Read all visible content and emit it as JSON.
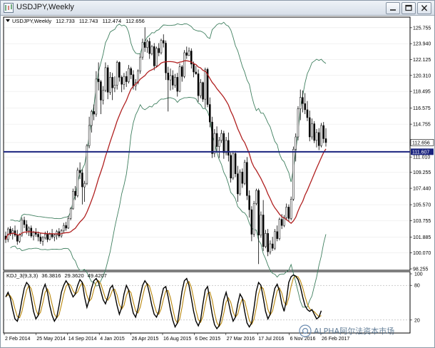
{
  "window": {
    "title": "USDJPY,Weekly"
  },
  "chart_info": {
    "symbol_line": "USDJPY,Weekly",
    "open": "112.733",
    "high": "112.743",
    "low": "112.474",
    "close": "112.656"
  },
  "indicator_info": {
    "name": "KDJ_3(9,3,3)",
    "k": "36.3816",
    "d": "29.3620",
    "j": "49.4207"
  },
  "price_axis": {
    "ticks": [
      "125.755",
      "123.940",
      "122.125",
      "120.310",
      "118.495",
      "116.575",
      "114.755",
      "112.656",
      "111.607",
      "111.010",
      "109.255",
      "107.440",
      "105.570",
      "103.755",
      "101.885",
      "100.070",
      "98.255"
    ],
    "current_price": "112.656",
    "line_price": "111.607"
  },
  "indicator_axis": {
    "ticks": [
      "100",
      "80",
      "20"
    ]
  },
  "time_axis": {
    "labels": [
      "2 Feb 2014",
      "25 May 2014",
      "14 Sep 2014",
      "4 Jan 2015",
      "26 Apr 2015",
      "16 Aug 2015",
      "6 Dec 2015",
      "27 Mar 2016",
      "17 Jul 2016",
      "6 Nov 2016",
      "26 Feb 2017"
    ]
  },
  "watermark": {
    "text": "ALPHA阿尔法资本市场"
  },
  "colors": {
    "bull": "#ffffff",
    "bear": "#000000",
    "ma": "#b02020",
    "bands": "#3f7f5f",
    "hline": "#1a237e",
    "k_line": "#000000",
    "d_line": "#b8860b",
    "grid": "#e4e4e4"
  },
  "chart_data": {
    "type": "candlestick",
    "title": "USDJPY,Weekly",
    "price_range": [
      98.255,
      126.8
    ],
    "horizontal_line": 111.607,
    "overlays": [
      "moving average (red)",
      "Bollinger bands (green)"
    ],
    "indicator": "KDJ_3(9,3,3)",
    "indicator_range": [
      0,
      100
    ],
    "bars": [
      [
        102.0,
        102.5,
        101.2,
        101.6
      ],
      [
        101.6,
        103.0,
        101.3,
        102.8
      ],
      [
        102.8,
        103.1,
        102.0,
        102.3
      ],
      [
        102.3,
        102.9,
        101.6,
        102.6
      ],
      [
        102.6,
        103.2,
        101.9,
        102.1
      ],
      [
        102.1,
        102.7,
        101.0,
        101.4
      ],
      [
        101.4,
        102.3,
        101.2,
        102.1
      ],
      [
        102.1,
        104.1,
        101.9,
        103.8
      ],
      [
        103.8,
        104.2,
        102.9,
        103.3
      ],
      [
        103.3,
        103.8,
        102.2,
        102.6
      ],
      [
        102.6,
        103.1,
        102.0,
        102.9
      ],
      [
        102.9,
        103.2,
        101.8,
        102.0
      ],
      [
        102.0,
        102.6,
        101.5,
        102.4
      ],
      [
        102.4,
        102.9,
        101.9,
        102.2
      ],
      [
        102.2,
        102.5,
        101.4,
        101.9
      ],
      [
        101.9,
        102.4,
        101.1,
        101.4
      ],
      [
        101.4,
        102.0,
        100.9,
        101.8
      ],
      [
        101.8,
        102.5,
        101.6,
        102.2
      ],
      [
        102.2,
        102.6,
        101.3,
        101.6
      ],
      [
        101.6,
        102.4,
        101.5,
        102.2
      ],
      [
        102.2,
        102.8,
        101.7,
        101.9
      ],
      [
        101.9,
        102.3,
        101.4,
        102.1
      ],
      [
        102.1,
        102.7,
        101.6,
        102.5
      ],
      [
        102.5,
        102.9,
        101.8,
        102.0
      ],
      [
        102.0,
        102.8,
        101.8,
        102.6
      ],
      [
        102.6,
        103.5,
        102.3,
        103.2
      ],
      [
        103.2,
        103.6,
        102.6,
        102.9
      ],
      [
        102.9,
        104.3,
        102.8,
        104.0
      ],
      [
        104.0,
        105.3,
        103.8,
        105.1
      ],
      [
        105.1,
        107.4,
        105.0,
        107.1
      ],
      [
        107.1,
        107.7,
        106.1,
        106.6
      ],
      [
        106.6,
        109.8,
        106.4,
        109.5
      ],
      [
        109.5,
        110.4,
        108.5,
        109.2
      ],
      [
        109.2,
        109.6,
        105.6,
        107.6
      ],
      [
        107.6,
        108.3,
        105.9,
        108.0
      ],
      [
        108.0,
        112.5,
        107.8,
        112.3
      ],
      [
        112.3,
        115.6,
        112.0,
        114.6
      ],
      [
        114.6,
        116.4,
        113.8,
        116.2
      ],
      [
        116.2,
        117.0,
        115.2,
        115.9
      ],
      [
        115.9,
        120.8,
        115.6,
        119.9
      ],
      [
        119.9,
        121.8,
        118.6,
        119.6
      ],
      [
        119.6,
        119.8,
        115.9,
        117.5
      ],
      [
        117.5,
        119.1,
        117.0,
        118.6
      ],
      [
        118.6,
        121.8,
        118.4,
        121.2
      ],
      [
        121.2,
        121.5,
        117.6,
        118.4
      ],
      [
        118.4,
        120.7,
        118.1,
        120.1
      ],
      [
        120.1,
        120.6,
        117.5,
        118.9
      ],
      [
        118.9,
        120.2,
        118.4,
        119.2
      ],
      [
        119.2,
        122.0,
        118.7,
        121.8
      ],
      [
        121.8,
        121.9,
        119.6,
        120.1
      ],
      [
        120.1,
        120.3,
        118.4,
        119.3
      ],
      [
        119.3,
        120.6,
        118.7,
        120.2
      ],
      [
        120.2,
        120.8,
        119.0,
        119.6
      ],
      [
        119.6,
        121.5,
        119.4,
        121.1
      ],
      [
        121.1,
        121.3,
        119.9,
        120.4
      ],
      [
        120.4,
        120.9,
        118.7,
        119.1
      ],
      [
        119.1,
        119.9,
        118.6,
        119.5
      ],
      [
        119.5,
        121.0,
        119.3,
        120.8
      ],
      [
        120.8,
        122.8,
        120.5,
        122.4
      ],
      [
        122.4,
        124.5,
        122.1,
        124.1
      ],
      [
        124.1,
        125.8,
        123.0,
        123.5
      ],
      [
        123.5,
        124.4,
        122.9,
        124.2
      ],
      [
        124.2,
        124.6,
        122.2,
        122.8
      ],
      [
        122.8,
        123.8,
        122.6,
        123.6
      ],
      [
        123.6,
        124.0,
        120.9,
        121.4
      ],
      [
        121.4,
        123.6,
        121.2,
        123.4
      ],
      [
        123.4,
        124.0,
        122.5,
        122.9
      ],
      [
        122.9,
        124.5,
        122.7,
        124.3
      ],
      [
        124.3,
        125.0,
        123.5,
        124.0
      ],
      [
        124.0,
        124.3,
        119.8,
        120.6
      ],
      [
        120.6,
        121.3,
        116.2,
        119.8
      ],
      [
        119.8,
        121.1,
        118.6,
        120.3
      ],
      [
        120.3,
        120.9,
        118.7,
        119.2
      ],
      [
        119.2,
        120.5,
        118.9,
        120.1
      ],
      [
        120.1,
        120.6,
        117.9,
        118.5
      ],
      [
        118.5,
        121.7,
        118.4,
        121.3
      ],
      [
        121.3,
        121.5,
        119.6,
        120.2
      ],
      [
        120.2,
        123.2,
        120.0,
        122.9
      ],
      [
        122.9,
        123.6,
        122.2,
        122.6
      ],
      [
        122.6,
        123.5,
        122.5,
        123.1
      ],
      [
        123.1,
        123.4,
        121.1,
        121.6
      ],
      [
        121.6,
        121.9,
        120.1,
        120.7
      ],
      [
        120.7,
        121.4,
        120.4,
        120.5
      ],
      [
        120.5,
        121.0,
        117.3,
        118.0
      ],
      [
        118.0,
        119.9,
        117.7,
        119.5
      ],
      [
        119.5,
        119.6,
        117.3,
        117.6
      ],
      [
        117.6,
        121.2,
        116.6,
        121.0
      ],
      [
        121.0,
        121.2,
        116.7,
        117.0
      ],
      [
        117.0,
        117.8,
        114.4,
        115.0
      ],
      [
        115.0,
        115.6,
        110.9,
        111.4
      ],
      [
        111.4,
        114.2,
        111.0,
        113.7
      ],
      [
        113.7,
        114.5,
        111.6,
        112.2
      ],
      [
        112.2,
        113.3,
        110.9,
        112.9
      ],
      [
        112.9,
        114.1,
        112.6,
        113.7
      ],
      [
        113.7,
        114.0,
        110.8,
        111.5
      ],
      [
        111.5,
        113.3,
        111.2,
        112.9
      ],
      [
        112.9,
        113.8,
        110.5,
        111.2
      ],
      [
        111.2,
        111.5,
        108.1,
        108.6
      ],
      [
        108.6,
        111.7,
        108.4,
        111.4
      ],
      [
        111.4,
        111.7,
        108.7,
        109.1
      ],
      [
        109.1,
        110.0,
        105.9,
        106.8
      ],
      [
        106.8,
        109.6,
        106.6,
        109.3
      ],
      [
        109.3,
        109.7,
        107.5,
        108.0
      ],
      [
        108.0,
        110.7,
        107.8,
        110.4
      ],
      [
        110.4,
        111.0,
        106.1,
        106.6
      ],
      [
        106.6,
        107.2,
        104.1,
        105.0
      ],
      [
        105.0,
        105.4,
        101.4,
        102.2
      ],
      [
        102.2,
        106.0,
        101.9,
        105.7
      ],
      [
        105.7,
        107.4,
        105.5,
        107.2
      ],
      [
        107.2,
        107.4,
        98.8,
        102.1
      ],
      [
        102.1,
        104.8,
        101.8,
        104.4
      ],
      [
        104.4,
        106.1,
        100.3,
        100.8
      ],
      [
        100.8,
        102.7,
        100.6,
        102.3
      ],
      [
        102.3,
        102.8,
        99.7,
        100.2
      ],
      [
        100.2,
        101.5,
        99.9,
        101.1
      ],
      [
        101.1,
        101.9,
        100.3,
        100.6
      ],
      [
        100.6,
        102.8,
        100.4,
        102.5
      ],
      [
        102.5,
        103.2,
        101.4,
        101.7
      ],
      [
        101.7,
        104.1,
        101.5,
        103.9
      ],
      [
        103.9,
        104.5,
        102.8,
        103.2
      ],
      [
        103.2,
        104.4,
        103.0,
        104.1
      ],
      [
        104.1,
        105.7,
        103.8,
        105.3
      ],
      [
        105.3,
        105.6,
        103.7,
        104.0
      ],
      [
        104.0,
        106.5,
        103.8,
        106.2
      ],
      [
        106.2,
        112.2,
        106.0,
        111.9
      ],
      [
        111.9,
        113.7,
        110.5,
        113.3
      ],
      [
        113.3,
        116.8,
        112.9,
        116.5
      ],
      [
        116.5,
        118.7,
        115.2,
        117.8
      ],
      [
        117.8,
        118.6,
        116.1,
        117.1
      ],
      [
        117.1,
        118.3,
        115.9,
        116.4
      ],
      [
        116.4,
        117.4,
        115.1,
        115.5
      ],
      [
        115.5,
        116.3,
        112.8,
        113.3
      ],
      [
        113.3,
        115.4,
        113.0,
        114.8
      ],
      [
        114.8,
        115.1,
        112.6,
        112.9
      ],
      [
        112.9,
        114.2,
        112.1,
        113.8
      ],
      [
        113.8,
        114.3,
        111.8,
        112.3
      ],
      [
        112.3,
        114.9,
        112.1,
        114.6
      ],
      [
        114.6,
        115.0,
        112.6,
        113.1
      ],
      [
        113.1,
        114.3,
        112.2,
        112.656
      ]
    ],
    "k_values": [
      60,
      68,
      58,
      38,
      22,
      18,
      32,
      55,
      75,
      85,
      80,
      58,
      35,
      22,
      28,
      50,
      72,
      82,
      68,
      45,
      28,
      18,
      25,
      45,
      68,
      80,
      88,
      82,
      70,
      60,
      65,
      80,
      90,
      85,
      60,
      42,
      55,
      75,
      88,
      92,
      85,
      70,
      55,
      48,
      60,
      75,
      80,
      65,
      45,
      30,
      42,
      65,
      80,
      72,
      50,
      32,
      25,
      40,
      62,
      80,
      88,
      82,
      65,
      45,
      30,
      25,
      35,
      58,
      75,
      78,
      60,
      38,
      20,
      8,
      15,
      42,
      70,
      88,
      92,
      80,
      58,
      35,
      18,
      10,
      20,
      48,
      72,
      78,
      55,
      30,
      12,
      5,
      10,
      30,
      55,
      68,
      52,
      32,
      18,
      25,
      48,
      65,
      58,
      35,
      15,
      8,
      15,
      40,
      70,
      85,
      80,
      58,
      35,
      22,
      30,
      55,
      75,
      82,
      70,
      48,
      35,
      55,
      85,
      95,
      98,
      96,
      90,
      78,
      60,
      45,
      38,
      35,
      38,
      30,
      22,
      25,
      36
    ]
  }
}
